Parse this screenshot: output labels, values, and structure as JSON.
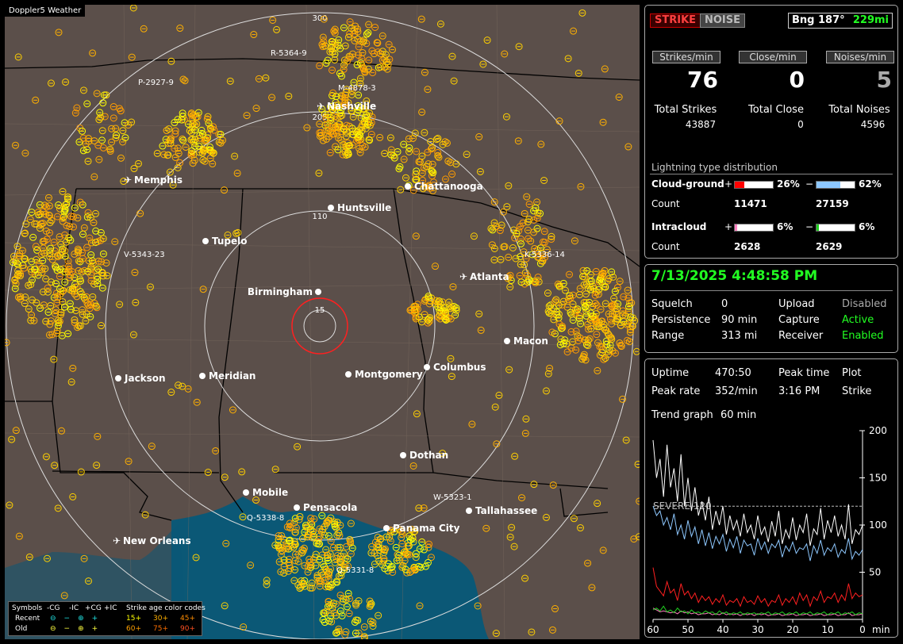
{
  "map": {
    "title": "Doppler5 Weather",
    "cities": [
      {
        "name": "Nashville",
        "kind": "airport"
      },
      {
        "name": "Memphis",
        "kind": "airport"
      },
      {
        "name": "Chattanooga",
        "kind": "dot"
      },
      {
        "name": "Huntsville",
        "kind": "dot"
      },
      {
        "name": "Tupelo",
        "kind": "dot"
      },
      {
        "name": "Birmingham",
        "kind": "dot"
      },
      {
        "name": "Atlanta",
        "kind": "airport"
      },
      {
        "name": "Macon",
        "kind": "dot"
      },
      {
        "name": "Columbus",
        "kind": "dot"
      },
      {
        "name": "Montgomery",
        "kind": "dot"
      },
      {
        "name": "Meridian",
        "kind": "dot"
      },
      {
        "name": "Jackson",
        "kind": "dot"
      },
      {
        "name": "Dothan",
        "kind": "dot"
      },
      {
        "name": "Mobile",
        "kind": "dot"
      },
      {
        "name": "Pensacola",
        "kind": "dot"
      },
      {
        "name": "Tallahassee",
        "kind": "dot"
      },
      {
        "name": "Panama City",
        "kind": "dot"
      },
      {
        "name": "New Orleans",
        "kind": "airport"
      }
    ],
    "ring_labels": [
      "300",
      "205",
      "110",
      "15"
    ],
    "storm_tracks": [
      "R-5364-9",
      "P-2927-9",
      "M-4878-3",
      "V-5343-23",
      "K-5336-14",
      "Q-5338-8",
      "W-5323-1",
      "Q-5331-8"
    ],
    "legend": {
      "symbols_label": "Symbols",
      "types": [
        "-CG",
        "-IC",
        "+CG",
        "+IC"
      ],
      "age_label": "Strike age color codes",
      "recent_label": "Recent",
      "old_label": "Old",
      "recent_ages": [
        "15+",
        "30+",
        "45+"
      ],
      "old_ages": [
        "60+",
        "75+",
        "90+"
      ],
      "recent_colors": [
        "#ffff00",
        "#ffb000",
        "#ff8c00"
      ],
      "old_colors": [
        "#ffa000",
        "#ff7000",
        "#ff5020"
      ]
    }
  },
  "stats": {
    "strike_button": "STRIKE",
    "noise_button": "NOISE",
    "bearing": "Bng 187°",
    "range": "229mi",
    "strikes_per_min_label": "Strikes/min",
    "close_per_min_label": "Close/min",
    "noises_per_min_label": "Noises/min",
    "strikes_per_min": "76",
    "close_per_min": "0",
    "noises_per_min": "5",
    "total_strikes_label": "Total Strikes",
    "total_close_label": "Total Close",
    "total_noises_label": "Total Noises",
    "total_strikes": "43887",
    "total_close": "0",
    "total_noises": "4596",
    "dist_title": "Lightning type distribution",
    "cg_label": "Cloud-ground",
    "ic_label": "Intracloud",
    "count_label": "Count",
    "plus": "+",
    "minus": "−",
    "cg_pos_pct": "26%",
    "cg_neg_pct": "62%",
    "cg_pos_count": "11471",
    "cg_neg_count": "27159",
    "ic_pos_pct": "6%",
    "ic_neg_pct": "6%",
    "ic_pos_count": "2628",
    "ic_neg_count": "2629",
    "bars": {
      "cg_pos": 0.26,
      "cg_neg": 0.62,
      "ic_pos": 0.06,
      "ic_neg": 0.06
    },
    "bar_colors": {
      "cg_pos": "#ff0000",
      "cg_neg": "#8ec8ff",
      "ic_pos": "#ff80c0",
      "ic_neg": "#20d020"
    }
  },
  "status": {
    "datetime": "7/13/2025 4:48:58 PM",
    "squelch_label": "Squelch",
    "squelch": "0",
    "persistence_label": "Persistence",
    "persistence": "90 min",
    "range_label": "Range",
    "range": "313 mi",
    "upload_label": "Upload",
    "upload": "Disabled",
    "capture_label": "Capture",
    "capture": "Active",
    "receiver_label": "Receiver",
    "receiver": "Enabled"
  },
  "trend": {
    "uptime_label": "Uptime",
    "uptime": "470:50",
    "peak_time_label": "Peak time",
    "peak_time": "3:16 PM",
    "plot_label": "Plot",
    "plot": "Strike",
    "peak_rate_label": "Peak rate",
    "peak_rate": "352/min",
    "trend_graph_label": "Trend graph",
    "trend_graph": "60 min",
    "severe_label": "SEVERE 120",
    "x_unit": "min",
    "chart_data": {
      "type": "line",
      "xlabel": "min",
      "x_ticks": [
        60,
        50,
        40,
        30,
        20,
        10,
        0
      ],
      "y_ticks": [
        50,
        100,
        150,
        200
      ],
      "ylim": [
        0,
        200
      ],
      "xlim": [
        60,
        0
      ],
      "threshold": 120,
      "series": [
        {
          "color": "#ffffff",
          "values": [
            190,
            150,
            170,
            130,
            185,
            140,
            160,
            125,
            175,
            120,
            150,
            115,
            140,
            110,
            125,
            105,
            130,
            95,
            115,
            100,
            120,
            90,
            110,
            95,
            105,
            88,
            112,
            92,
            100,
            85,
            110,
            90,
            98,
            82,
            104,
            88,
            115,
            80,
            95,
            86,
            108,
            84,
            100,
            92,
            112,
            78,
            96,
            90,
            118,
            85,
            105,
            92,
            110,
            88,
            100,
            85,
            122,
            80,
            95,
            90,
            100
          ]
        },
        {
          "color": "#8ec8ff",
          "values": [
            120,
            110,
            115,
            100,
            108,
            95,
            112,
            90,
            100,
            85,
            105,
            88,
            98,
            80,
            95,
            78,
            92,
            75,
            88,
            80,
            90,
            72,
            85,
            76,
            88,
            70,
            84,
            78,
            80,
            68,
            86,
            74,
            82,
            70,
            80,
            76,
            84,
            66,
            78,
            72,
            82,
            70,
            76,
            74,
            80,
            62,
            78,
            70,
            84,
            68,
            76,
            72,
            80,
            66,
            74,
            70,
            86,
            64,
            72,
            68,
            74
          ]
        },
        {
          "color": "#ff2020",
          "values": [
            55,
            35,
            30,
            25,
            40,
            28,
            32,
            20,
            38,
            26,
            30,
            22,
            28,
            18,
            25,
            20,
            24,
            16,
            22,
            18,
            26,
            15,
            20,
            18,
            22,
            14,
            24,
            18,
            20,
            16,
            25,
            18,
            22,
            14,
            20,
            18,
            26,
            15,
            22,
            18,
            24,
            16,
            28,
            20,
            26,
            14,
            24,
            20,
            30,
            18,
            24,
            22,
            28,
            18,
            26,
            20,
            38,
            22,
            28,
            24,
            26
          ]
        },
        {
          "color": "#ff80c0",
          "values": [
            12,
            10,
            8,
            9,
            8,
            7,
            8,
            6,
            9,
            7,
            8,
            6,
            7,
            5,
            6,
            6,
            7,
            5,
            6,
            5,
            7,
            5,
            6,
            5,
            6,
            4,
            6,
            5,
            6,
            4,
            6,
            5,
            6,
            4,
            5,
            5,
            6,
            4,
            5,
            5,
            6,
            4,
            5,
            5,
            6,
            4,
            5,
            5,
            6,
            4,
            5,
            5,
            6,
            4,
            5,
            5,
            7,
            4,
            5,
            5,
            6
          ]
        },
        {
          "color": "#20d020",
          "values": [
            10,
            12,
            9,
            14,
            8,
            10,
            7,
            12,
            8,
            9,
            6,
            10,
            7,
            8,
            6,
            9,
            7,
            8,
            5,
            9,
            6,
            8,
            5,
            7,
            6,
            8,
            5,
            7,
            6,
            7,
            5,
            7,
            6,
            8,
            5,
            7,
            6,
            8,
            5,
            7,
            6,
            8,
            5,
            7,
            6,
            8,
            5,
            7,
            6,
            8,
            5,
            7,
            6,
            8,
            5,
            7,
            6,
            8,
            5,
            7,
            6
          ]
        }
      ]
    }
  }
}
